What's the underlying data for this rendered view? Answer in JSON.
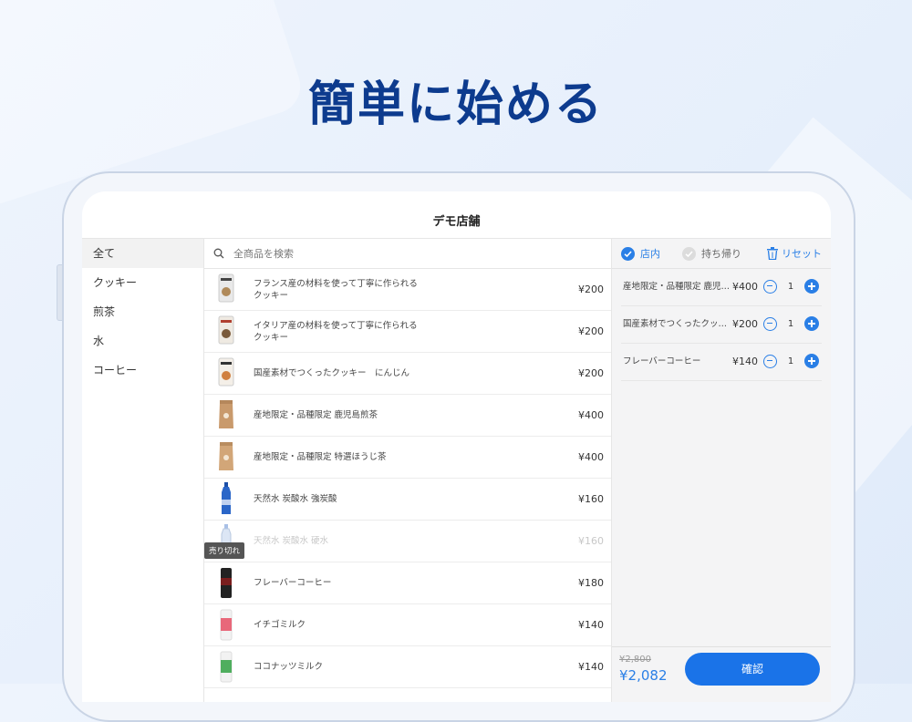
{
  "headline": "簡単に始める",
  "store_name": "デモ店舗",
  "categories": [
    "全て",
    "クッキー",
    "煎茶",
    "水",
    "コーヒー"
  ],
  "search": {
    "placeholder": "全商品を検索"
  },
  "products": [
    {
      "name": "フランス産の材料を使って丁寧に作られるクッキー",
      "price": "¥200"
    },
    {
      "name": "イタリア産の材料を使って丁寧に作られるクッキー",
      "price": "¥200"
    },
    {
      "name": "国産素材でつくったクッキー　にんじん",
      "price": "¥200"
    },
    {
      "name": "産地限定・品種限定 鹿児島煎茶",
      "price": "¥400"
    },
    {
      "name": "産地限定・品種限定 特選ほうじ茶",
      "price": "¥400"
    },
    {
      "name": "天然水 炭酸水 強炭酸",
      "price": "¥160"
    },
    {
      "name": "天然水 炭酸水 硬水",
      "price": "¥160",
      "badge": "売り切れ"
    },
    {
      "name": "フレーバーコーヒー",
      "price": "¥180"
    },
    {
      "name": "イチゴミルク",
      "price": "¥140"
    },
    {
      "name": "ココナッツミルク",
      "price": "¥140"
    }
  ],
  "cart": {
    "option_in_store": "店内",
    "option_takeout": "持ち帰り",
    "reset_label": "リセット",
    "items": [
      {
        "name": "産地限定・品種限定 鹿児島...",
        "price": "¥400",
        "qty": "1"
      },
      {
        "name": "国産素材でつくったクッキー...",
        "price": "¥200",
        "qty": "1"
      },
      {
        "name": "フレーバーコーヒー",
        "price": "¥140",
        "qty": "1"
      }
    ],
    "original_total": "¥2,800",
    "total": "¥2,082",
    "confirm_label": "確認"
  },
  "colors": {
    "accent": "#2a7fe6",
    "headline": "#0d3b8e",
    "button": "#1a73e8"
  }
}
